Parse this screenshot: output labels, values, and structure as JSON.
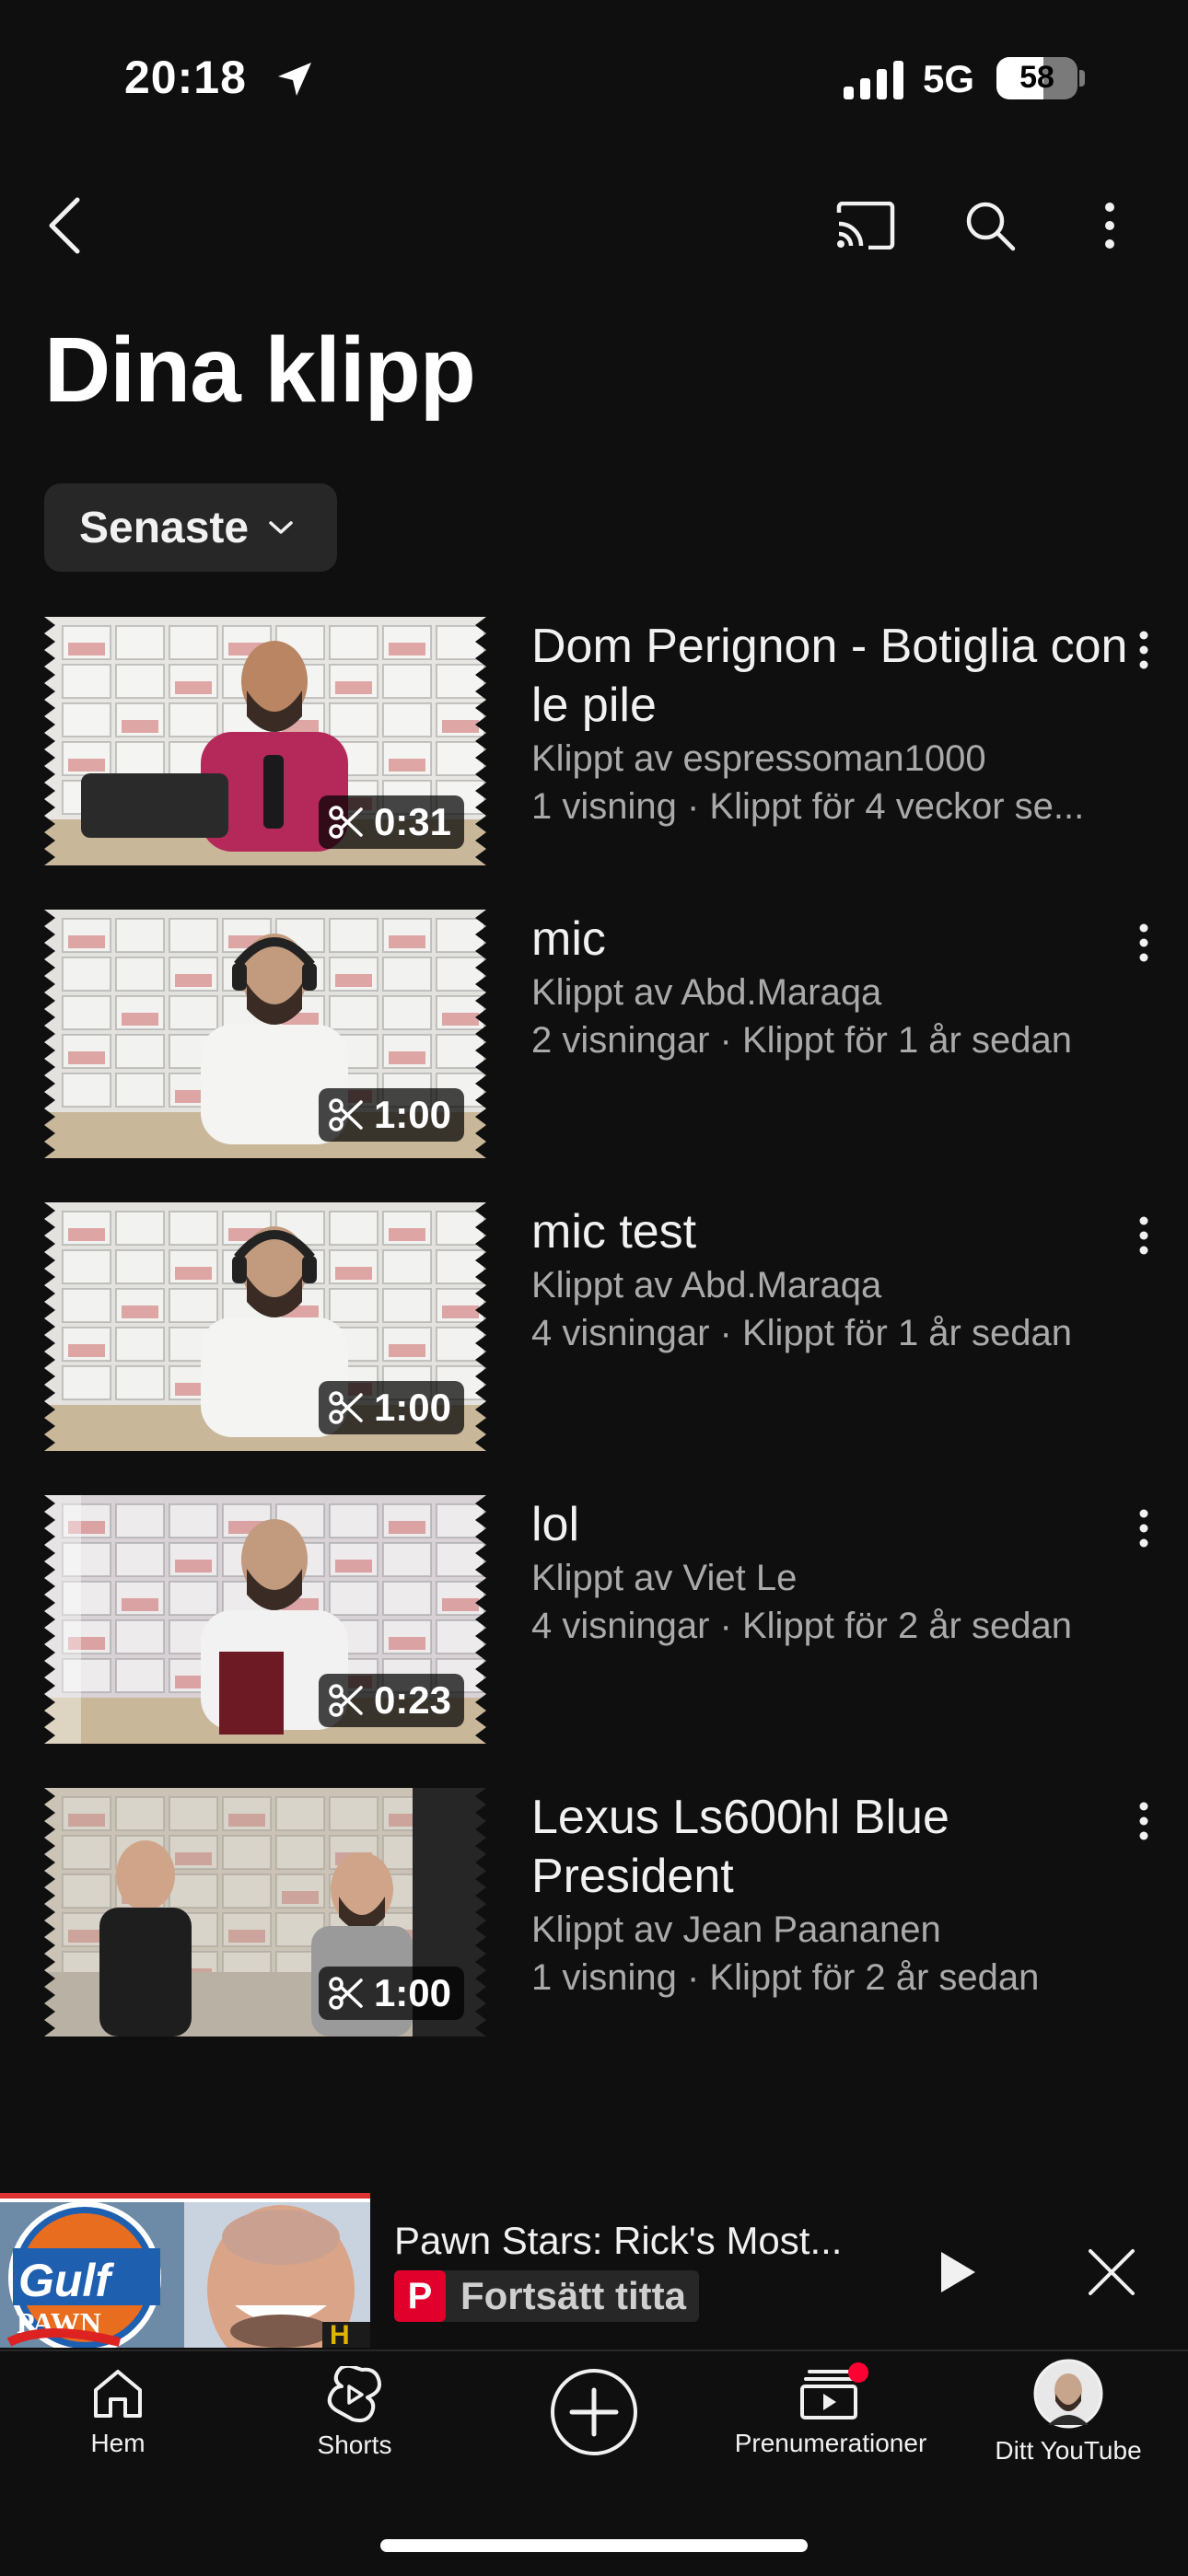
{
  "status": {
    "time": "20:18",
    "network": "5G",
    "battery": "58",
    "battery_level": 0.58
  },
  "header": {
    "title": "Dina klipp",
    "icons": [
      "back-icon",
      "cast-icon",
      "search-icon",
      "more-vertical-icon"
    ]
  },
  "sort": {
    "label": "Senaste"
  },
  "clips": [
    {
      "title": "Dom Perignon - Botiglia con le pile",
      "clipped_by": "Klippt av espressoman1000",
      "stats": "1 visning · Klippt för 4 veckor se...",
      "duration": "0:31"
    },
    {
      "title": "mic",
      "clipped_by": "Klippt av Abd.Maraqa",
      "stats": "2 visningar · Klippt för 1 år sedan",
      "duration": "1:00"
    },
    {
      "title": "mic test",
      "clipped_by": "Klippt av Abd.Maraqa",
      "stats": "4 visningar · Klippt för 1 år sedan",
      "duration": "1:00"
    },
    {
      "title": "lol",
      "clipped_by": "Klippt av Viet Le",
      "stats": "4 visningar · Klippt för 2 år sedan",
      "duration": "0:23"
    },
    {
      "title": "Lexus Ls600hl Blue President",
      "clipped_by": "Klippt av Jean Paananen",
      "stats": "1 visning · Klippt för 2 år sedan",
      "duration": "1:00"
    }
  ],
  "miniplayer": {
    "title": "Pawn Stars: Rick's Most...",
    "badge": "P",
    "action": "Fortsätt titta",
    "thumb_text_1": "Gulf",
    "thumb_text_2": "PAWN"
  },
  "nav": [
    {
      "label": "Hem",
      "icon": "home-icon"
    },
    {
      "label": "Shorts",
      "icon": "shorts-icon"
    },
    {
      "label": "",
      "icon": "create-icon"
    },
    {
      "label": "Prenumerationer",
      "icon": "subscriptions-icon"
    },
    {
      "label": "Ditt YouTube",
      "icon": "avatar"
    }
  ],
  "colors": {
    "background": "#0f0f0f",
    "chip": "#272727",
    "secondary_text": "#aaaaaa",
    "accent_red": "#e1002b"
  }
}
